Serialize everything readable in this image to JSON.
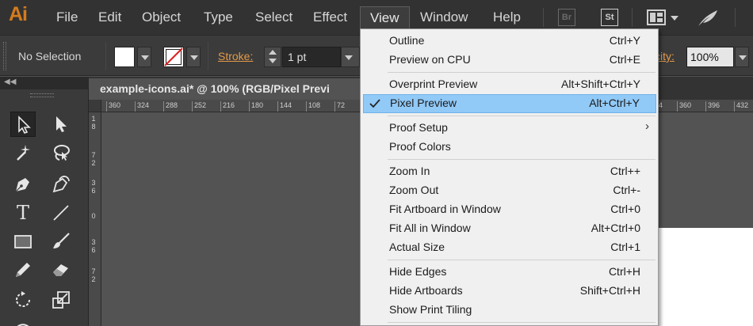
{
  "app": {
    "logo": "Ai"
  },
  "menubar": {
    "items": [
      "File",
      "Edit",
      "Object",
      "Type",
      "Select",
      "Effect",
      "View",
      "Window",
      "Help"
    ],
    "active": "View",
    "bridge_badge": "Br",
    "stock_badge": "St",
    "icons": [
      "arrange-documents-icon",
      "workspace-switcher-icon"
    ]
  },
  "controlbar": {
    "selection": "No Selection",
    "stroke_label": "Stroke:",
    "stroke_weight": "1 pt",
    "opacity_label": "Opacity:",
    "opacity_label_visible": "city:",
    "opacity_value": "100%",
    "fill_color": "#ffffff",
    "stroke_color": "none"
  },
  "document": {
    "tab_title": "example-icons.ai* @ 100% (RGB/Pixel Previ",
    "hruler_ticks": [
      "360",
      "324",
      "288",
      "252",
      "216",
      "180",
      "144",
      "108",
      "72",
      "4",
      "360",
      "396",
      "432"
    ],
    "vruler_ticks": [
      [
        "1",
        "8"
      ],
      [
        "7",
        "2"
      ],
      [
        "3",
        "6"
      ],
      [
        "0"
      ],
      [
        "3",
        "6"
      ],
      [
        "7",
        "2"
      ]
    ]
  },
  "view_menu": {
    "groups": [
      [
        {
          "label": "Outline",
          "shortcut": "Ctrl+Y"
        },
        {
          "label": "Preview on CPU",
          "shortcut": "Ctrl+E"
        }
      ],
      [
        {
          "label": "Overprint Preview",
          "shortcut": "Alt+Shift+Ctrl+Y"
        },
        {
          "label": "Pixel Preview",
          "shortcut": "Alt+Ctrl+Y",
          "checked": true,
          "highlighted": true
        }
      ],
      [
        {
          "label": "Proof Setup",
          "shortcut": "",
          "submenu": true
        },
        {
          "label": "Proof Colors",
          "shortcut": ""
        }
      ],
      [
        {
          "label": "Zoom In",
          "shortcut": "Ctrl++"
        },
        {
          "label": "Zoom Out",
          "shortcut": "Ctrl+-"
        },
        {
          "label": "Fit Artboard in Window",
          "shortcut": "Ctrl+0"
        },
        {
          "label": "Fit All in Window",
          "shortcut": "Alt+Ctrl+0"
        },
        {
          "label": "Actual Size",
          "shortcut": "Ctrl+1"
        }
      ],
      [
        {
          "label": "Hide Edges",
          "shortcut": "Ctrl+H"
        },
        {
          "label": "Hide Artboards",
          "shortcut": "Shift+Ctrl+H"
        },
        {
          "label": "Show Print Tiling",
          "shortcut": ""
        }
      ]
    ]
  },
  "colors": {
    "highlight": "#91c9f7",
    "accent_orange": "#e39a4a",
    "logo_orange": "#d47b1c"
  }
}
